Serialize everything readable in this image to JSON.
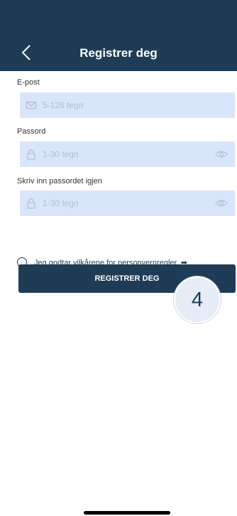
{
  "header": {
    "title": "Registrer deg",
    "back_icon": "chevron-left-icon"
  },
  "form": {
    "email": {
      "label": "E-post",
      "placeholder": "5-128 tegn",
      "icon": "mail-icon"
    },
    "password": {
      "label": "Passord",
      "placeholder": "1-30 tegn",
      "icon": "lock-icon",
      "toggle_icon": "eye-icon"
    },
    "password_repeat": {
      "label": "Skriv inn passordet igjen",
      "placeholder": "1-30 tegn",
      "icon": "lock-icon",
      "toggle_icon": "eye-icon"
    }
  },
  "agreement": {
    "text": "Jeg godtar vilkårene for personvernregler.",
    "arrow_icon": "arrow-right-icon",
    "checked": false
  },
  "submit": {
    "label": "REGISTRER DEG"
  },
  "badge": {
    "value": "4"
  },
  "colors": {
    "primary": "#1f3c57",
    "field_bg": "#d9e5fb",
    "placeholder": "#b3bfd3"
  }
}
